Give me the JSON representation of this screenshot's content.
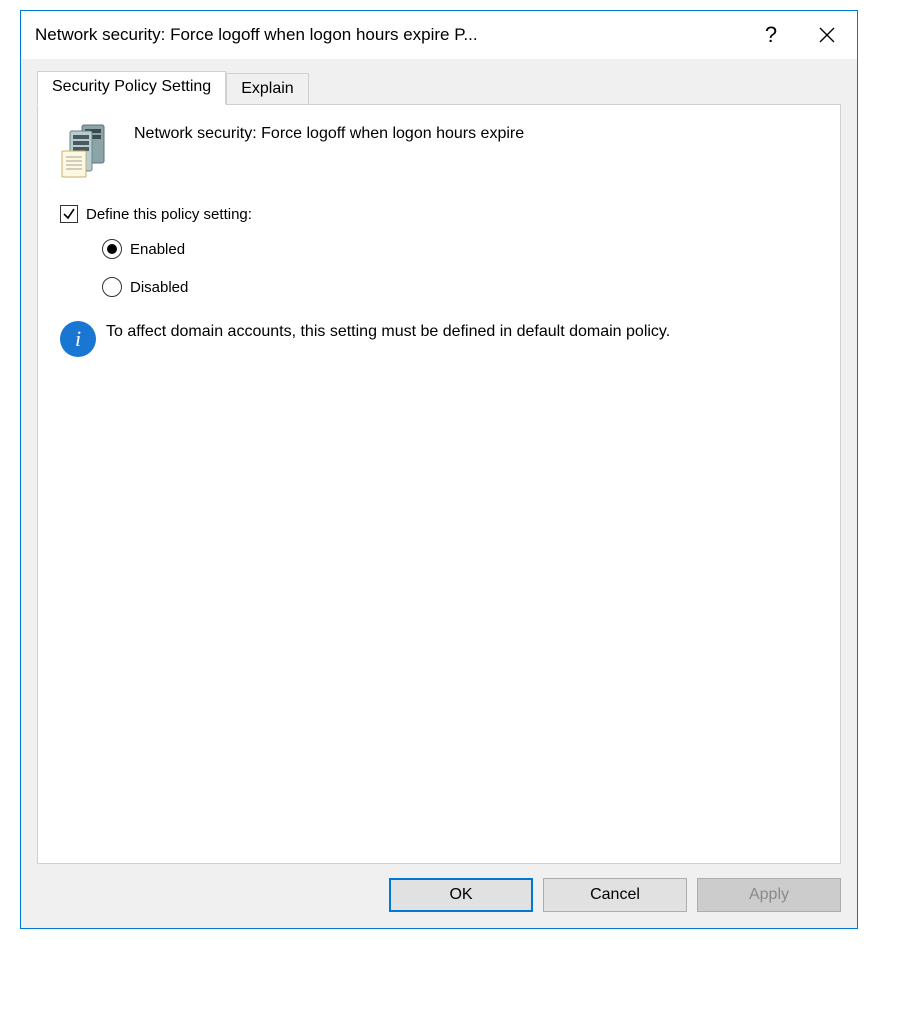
{
  "titlebar": {
    "title": "Network security: Force logoff when logon hours expire P..."
  },
  "tabs": {
    "security": "Security Policy Setting",
    "explain": "Explain"
  },
  "policy": {
    "title": "Network security: Force logoff when logon hours expire",
    "define_label": "Define this policy setting:",
    "define_checked": true,
    "options": {
      "enabled": "Enabled",
      "disabled": "Disabled",
      "selected": "enabled"
    },
    "info_text": "To affect domain accounts, this setting must be defined in default domain policy."
  },
  "buttons": {
    "ok": "OK",
    "cancel": "Cancel",
    "apply": "Apply"
  }
}
